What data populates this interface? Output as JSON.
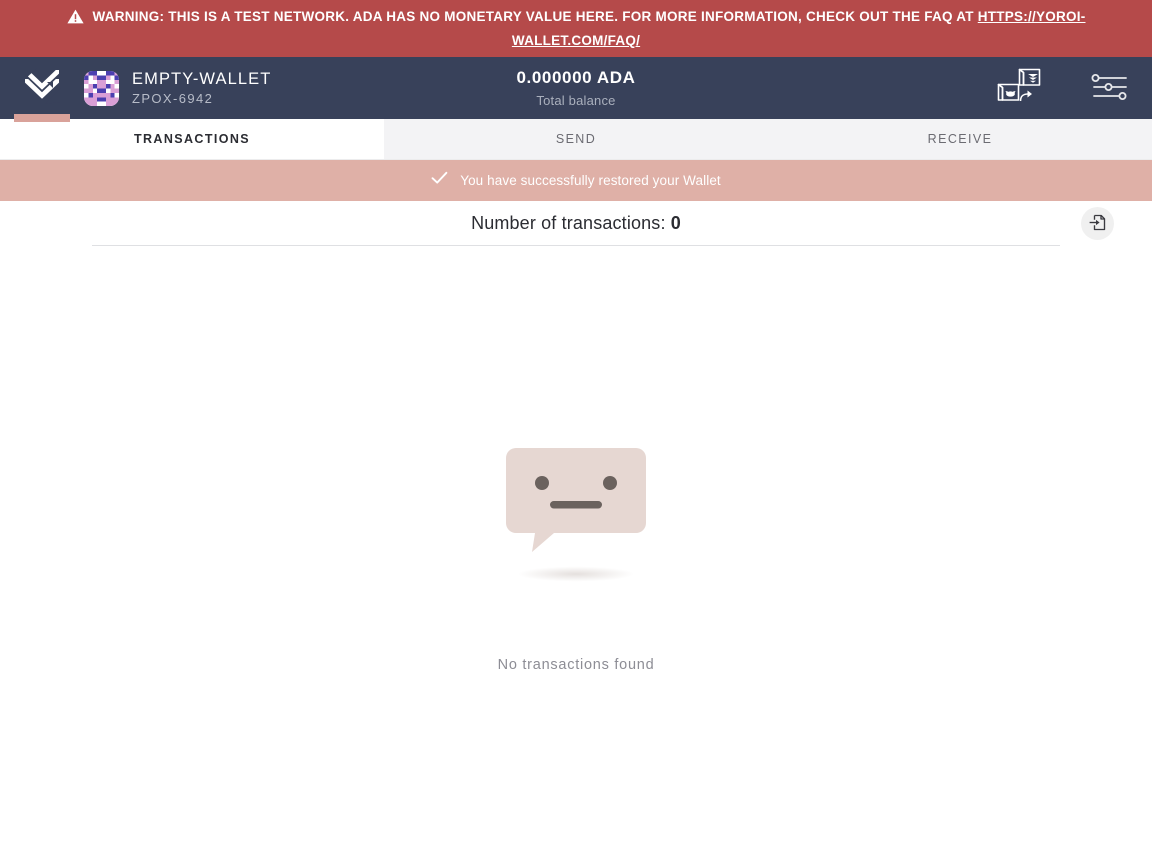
{
  "warning": {
    "icon": "warning-triangle-icon",
    "text_before": "Warning: this is a test network. ADA has no monetary value here. For more information, check out the FAQ at ",
    "link_text": "https://yoroi-wallet.com/faq/",
    "background_color": "#b54a4a",
    "text_color": "#ffffff"
  },
  "navbar": {
    "logo_icon": "yoroi-logo-icon",
    "accent_color": "#d9a29a",
    "background_color": "#38415a",
    "wallet": {
      "avatar_icon": "wallet-identicon-avatar",
      "name": "Empty-wallet",
      "plate": "ZPOX-6942"
    },
    "balance": {
      "amount": "0.000000 ADA",
      "label": "Total balance"
    },
    "actions": [
      {
        "name": "switch-wallet-button",
        "icon": "wallet-switch-icon"
      },
      {
        "name": "settings-button",
        "icon": "settings-sliders-icon"
      }
    ]
  },
  "tabs": [
    {
      "label": "Transactions",
      "active": true
    },
    {
      "label": "Send",
      "active": false
    },
    {
      "label": "Receive",
      "active": false
    }
  ],
  "notification": {
    "icon": "check-icon",
    "message": "You have successfully restored your Wallet",
    "background_color": "#dfb0a7"
  },
  "content": {
    "transactions_count_label": "Number of transactions:",
    "transactions_count_value": "0",
    "export_button_icon": "export-file-icon",
    "empty_state": {
      "illustration": "neutral-face-speech-bubble-illustration",
      "text": "No transactions found"
    }
  }
}
